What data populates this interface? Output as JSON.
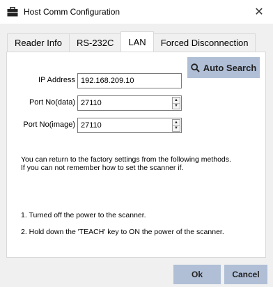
{
  "window": {
    "title": "Host Comm Configuration"
  },
  "tabs": [
    {
      "label": "Reader Info",
      "active": false
    },
    {
      "label": "RS-232C",
      "active": false
    },
    {
      "label": "LAN",
      "active": true
    },
    {
      "label": "Forced Disconnection",
      "active": false
    }
  ],
  "lan": {
    "ip_label": "IP Address",
    "ip_value": "192.168.209.10",
    "port_data_label": "Port No(data)",
    "port_data_value": "27110",
    "port_image_label": "Port No(image)",
    "port_image_value": "27110",
    "auto_search_label": "Auto Search"
  },
  "info": {
    "line1": "You can return to the factory settings from the following methods.",
    "line2": "If you can not remember how to set the scanner if.",
    "step1": "1. Turned off the power to the scanner.",
    "step2": "2. Hold down the 'TEACH' key to ON the power of the scanner."
  },
  "buttons": {
    "ok": "Ok",
    "cancel": "Cancel"
  },
  "icons": {
    "title": "briefcase-icon",
    "search": "search-icon",
    "close": "close-icon"
  },
  "colors": {
    "button": "#b0bfd6",
    "panel": "#ffffff",
    "window": "#f0f0f0"
  }
}
